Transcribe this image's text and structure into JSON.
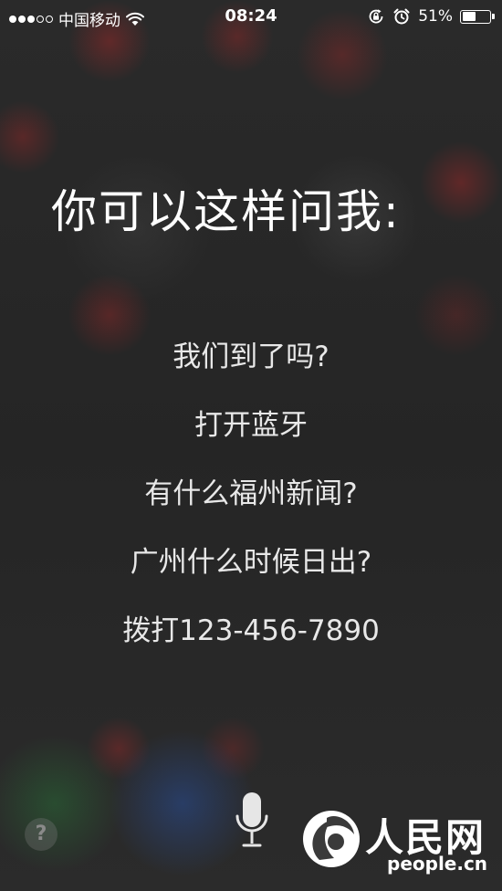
{
  "status_bar": {
    "signal_strength": 3,
    "signal_max": 5,
    "carrier": "中国移动",
    "time": "08:24",
    "battery_text": "51%",
    "battery_level": 0.51,
    "icons": [
      "wifi-icon",
      "orientation-lock-icon",
      "alarm-icon",
      "battery-icon"
    ]
  },
  "siri": {
    "heading": "你可以这样问我:",
    "suggestions": [
      "我们到了吗?",
      "打开蓝牙",
      "有什么福州新闻?",
      "广州什么时候日出?",
      "拨打123-456-7890"
    ],
    "help_label": "?",
    "mic_icon": "microphone-icon"
  },
  "watermark": {
    "name": "人民网",
    "domain": "people.cn"
  },
  "colors": {
    "background": "#262626",
    "text": "#ffffff",
    "suggestion_text": "#e8e8e8"
  }
}
